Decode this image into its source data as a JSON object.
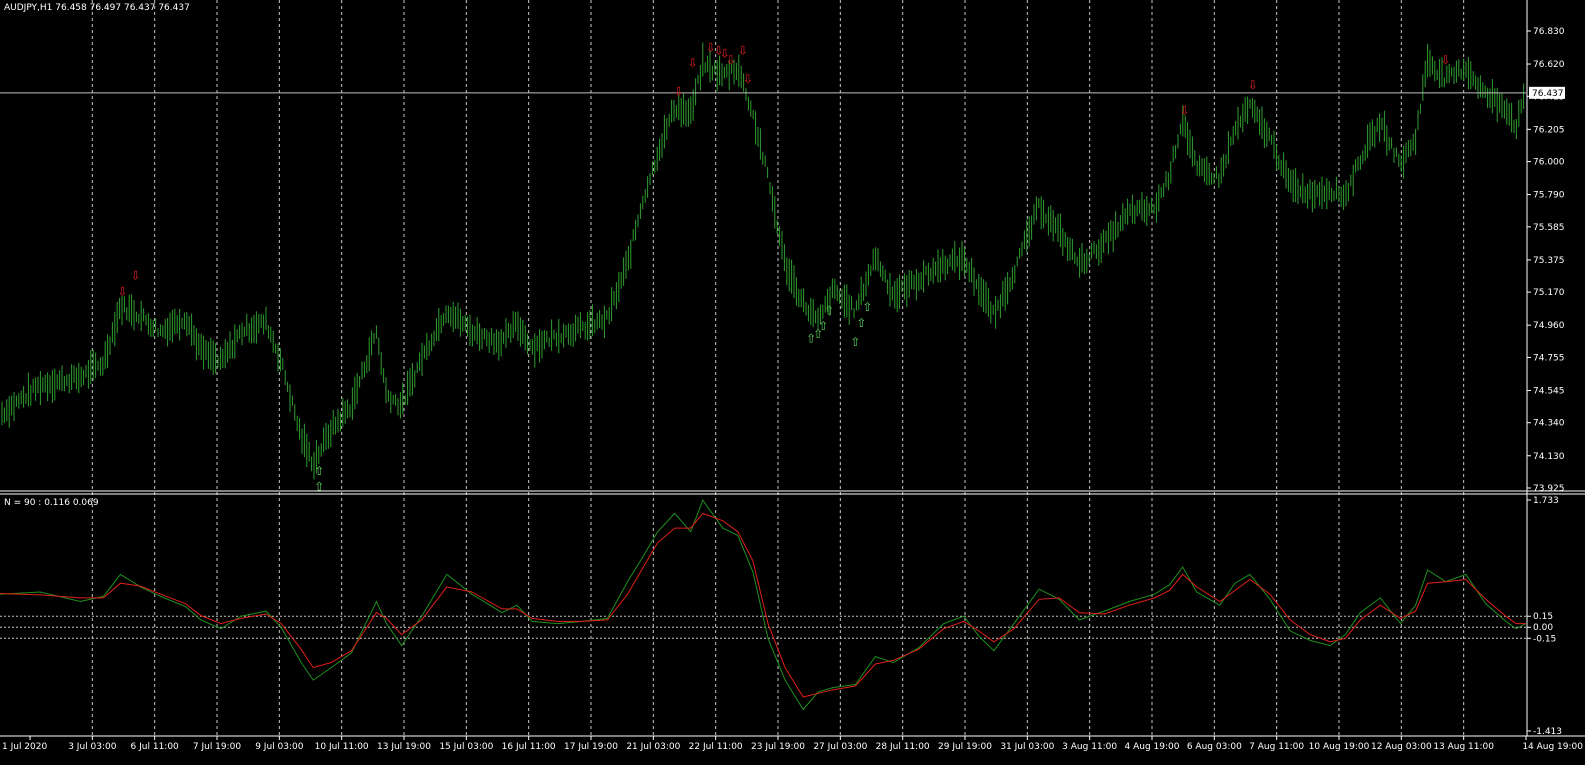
{
  "colors": {
    "background": "#000000",
    "foreground": "#ffffff",
    "grid": "#c8c8c8",
    "candle": "#2f9e2f",
    "indicator_fast": "#1f8f1f",
    "indicator_slow": "#e0201a",
    "arrow_up": "#5fd35f",
    "arrow_down": "#e02020",
    "price_line": "#c0c0c0"
  },
  "chart_data": [
    {
      "type": "candlestick",
      "header": "AUDJPY,H1  76.458 76.497 76.437 76.437",
      "symbol": "AUDJPY",
      "timeframe": "H1",
      "ohlc_last": {
        "open": 76.458,
        "high": 76.497,
        "low": 76.437,
        "close": 76.437
      },
      "current_price_label": "76.437",
      "ylim": [
        73.925,
        76.83
      ],
      "yticks": [
        "76.830",
        "76.620",
        "76.415",
        "76.205",
        "76.000",
        "75.790",
        "75.585",
        "75.375",
        "75.170",
        "74.960",
        "74.755",
        "74.545",
        "74.340",
        "74.130",
        "73.925"
      ],
      "xticks": [
        "1 Jul 2020",
        "3 Jul 03:00",
        "6 Jul 11:00",
        "7 Jul 19:00",
        "9 Jul 03:00",
        "10 Jul 11:00",
        "13 Jul 19:00",
        "15 Jul 03:00",
        "16 Jul 11:00",
        "17 Jul 19:00",
        "21 Jul 03:00",
        "22 Jul 11:00",
        "23 Jul 19:00",
        "27 Jul 03:00",
        "28 Jul 11:00",
        "29 Jul 19:00",
        "31 Jul 03:00",
        "3 Aug 11:00",
        "4 Aug 19:00",
        "6 Aug 03:00",
        "7 Aug 11:00",
        "10 Aug 19:00",
        "12 Aug 03:00",
        "13 Aug 11:00",
        "14 Aug 19:00"
      ],
      "x_index_range": [
        0,
        1520
      ],
      "price_path": [
        [
          0,
          74.39
        ],
        [
          40,
          74.58
        ],
        [
          80,
          74.63
        ],
        [
          103,
          74.72
        ],
        [
          120,
          75.08
        ],
        [
          140,
          75.02
        ],
        [
          160,
          74.92
        ],
        [
          185,
          75.01
        ],
        [
          200,
          74.8
        ],
        [
          220,
          74.72
        ],
        [
          240,
          74.92
        ],
        [
          265,
          74.98
        ],
        [
          280,
          74.73
        ],
        [
          300,
          74.25
        ],
        [
          312,
          74.08
        ],
        [
          330,
          74.3
        ],
        [
          350,
          74.45
        ],
        [
          375,
          74.92
        ],
        [
          385,
          74.52
        ],
        [
          400,
          74.45
        ],
        [
          420,
          74.75
        ],
        [
          445,
          75.06
        ],
        [
          470,
          74.92
        ],
        [
          500,
          74.85
        ],
        [
          515,
          74.97
        ],
        [
          530,
          74.82
        ],
        [
          555,
          74.9
        ],
        [
          580,
          74.94
        ],
        [
          605,
          75.0
        ],
        [
          625,
          75.35
        ],
        [
          640,
          75.75
        ],
        [
          655,
          76.05
        ],
        [
          672,
          76.35
        ],
        [
          688,
          76.3
        ],
        [
          700,
          76.62
        ],
        [
          720,
          76.55
        ],
        [
          735,
          76.6
        ],
        [
          750,
          76.3
        ],
        [
          765,
          75.9
        ],
        [
          782,
          75.35
        ],
        [
          800,
          75.1
        ],
        [
          815,
          74.98
        ],
        [
          830,
          75.18
        ],
        [
          852,
          75.05
        ],
        [
          872,
          75.4
        ],
        [
          890,
          75.15
        ],
        [
          915,
          75.25
        ],
        [
          940,
          75.35
        ],
        [
          960,
          75.38
        ],
        [
          975,
          75.2
        ],
        [
          990,
          75.02
        ],
        [
          1010,
          75.3
        ],
        [
          1035,
          75.72
        ],
        [
          1055,
          75.55
        ],
        [
          1075,
          75.35
        ],
        [
          1100,
          75.48
        ],
        [
          1125,
          75.68
        ],
        [
          1150,
          75.7
        ],
        [
          1165,
          75.92
        ],
        [
          1178,
          76.28
        ],
        [
          1192,
          75.95
        ],
        [
          1215,
          75.9
        ],
        [
          1230,
          76.2
        ],
        [
          1245,
          76.35
        ],
        [
          1265,
          76.15
        ],
        [
          1285,
          75.85
        ],
        [
          1305,
          75.8
        ],
        [
          1325,
          75.82
        ],
        [
          1340,
          75.78
        ],
        [
          1355,
          76.02
        ],
        [
          1375,
          76.25
        ],
        [
          1395,
          75.98
        ],
        [
          1410,
          76.15
        ],
        [
          1422,
          76.65
        ],
        [
          1440,
          76.52
        ],
        [
          1460,
          76.6
        ],
        [
          1480,
          76.42
        ],
        [
          1500,
          76.35
        ],
        [
          1510,
          76.22
        ],
        [
          1520,
          76.44
        ]
      ],
      "signals_down": [
        [
          122,
          75.15
        ],
        [
          135,
          75.25
        ],
        [
          676,
          76.42
        ],
        [
          690,
          76.6
        ],
        [
          708,
          76.7
        ],
        [
          716,
          76.68
        ],
        [
          722,
          76.66
        ],
        [
          728,
          76.62
        ],
        [
          740,
          76.68
        ],
        [
          745,
          76.5
        ],
        [
          1180,
          76.3
        ],
        [
          1248,
          76.46
        ],
        [
          1440,
          76.62
        ]
      ],
      "signals_up": [
        [
          318,
          74.06
        ],
        [
          318,
          73.96
        ],
        [
          808,
          74.9
        ],
        [
          815,
          74.93
        ],
        [
          820,
          74.98
        ],
        [
          826,
          75.08
        ],
        [
          852,
          74.88
        ],
        [
          858,
          75.0
        ],
        [
          864,
          75.1
        ]
      ]
    },
    {
      "type": "line",
      "header": "N = 90 :  0.116 0.069",
      "ylim": [
        -1.413,
        1.733
      ],
      "yticks": [
        "1.733",
        "0.15",
        "0.00",
        "-0.15",
        "-1.413"
      ],
      "levels": [
        0.15,
        0.0,
        -0.15
      ],
      "x_index_range": [
        0,
        1520
      ],
      "series": [
        {
          "key": "fast",
          "values": [
            [
              0,
              0.45
            ],
            [
              40,
              0.48
            ],
            [
              80,
              0.35
            ],
            [
              103,
              0.42
            ],
            [
              120,
              0.72
            ],
            [
              140,
              0.55
            ],
            [
              160,
              0.42
            ],
            [
              185,
              0.28
            ],
            [
              200,
              0.1
            ],
            [
              220,
              -0.02
            ],
            [
              240,
              0.15
            ],
            [
              265,
              0.22
            ],
            [
              280,
              0.0
            ],
            [
              300,
              -0.48
            ],
            [
              312,
              -0.72
            ],
            [
              330,
              -0.55
            ],
            [
              350,
              -0.35
            ],
            [
              375,
              0.35
            ],
            [
              385,
              0.05
            ],
            [
              400,
              -0.25
            ],
            [
              420,
              0.15
            ],
            [
              445,
              0.72
            ],
            [
              470,
              0.45
            ],
            [
              500,
              0.2
            ],
            [
              515,
              0.3
            ],
            [
              530,
              0.08
            ],
            [
              555,
              0.05
            ],
            [
              580,
              0.08
            ],
            [
              605,
              0.12
            ],
            [
              625,
              0.62
            ],
            [
              640,
              0.95
            ],
            [
              655,
              1.3
            ],
            [
              672,
              1.55
            ],
            [
              688,
              1.3
            ],
            [
              700,
              1.73
            ],
            [
              720,
              1.35
            ],
            [
              735,
              1.25
            ],
            [
              750,
              0.75
            ],
            [
              765,
              -0.15
            ],
            [
              782,
              -0.72
            ],
            [
              800,
              -1.12
            ],
            [
              815,
              -0.88
            ],
            [
              830,
              -0.82
            ],
            [
              852,
              -0.78
            ],
            [
              872,
              -0.4
            ],
            [
              890,
              -0.48
            ],
            [
              915,
              -0.28
            ],
            [
              940,
              0.05
            ],
            [
              960,
              0.15
            ],
            [
              975,
              -0.12
            ],
            [
              990,
              -0.32
            ],
            [
              1010,
              0.05
            ],
            [
              1035,
              0.52
            ],
            [
              1055,
              0.38
            ],
            [
              1075,
              0.1
            ],
            [
              1100,
              0.22
            ],
            [
              1125,
              0.35
            ],
            [
              1150,
              0.45
            ],
            [
              1165,
              0.58
            ],
            [
              1178,
              0.82
            ],
            [
              1192,
              0.48
            ],
            [
              1215,
              0.3
            ],
            [
              1230,
              0.6
            ],
            [
              1245,
              0.72
            ],
            [
              1265,
              0.38
            ],
            [
              1285,
              -0.05
            ],
            [
              1305,
              -0.18
            ],
            [
              1325,
              -0.25
            ],
            [
              1340,
              -0.1
            ],
            [
              1355,
              0.2
            ],
            [
              1375,
              0.4
            ],
            [
              1395,
              0.05
            ],
            [
              1410,
              0.3
            ],
            [
              1422,
              0.78
            ],
            [
              1440,
              0.62
            ],
            [
              1460,
              0.72
            ],
            [
              1480,
              0.32
            ],
            [
              1500,
              0.08
            ],
            [
              1510,
              -0.02
            ],
            [
              1520,
              0.05
            ]
          ]
        },
        {
          "key": "slow",
          "values": [
            [
              0,
              0.46
            ],
            [
              40,
              0.44
            ],
            [
              80,
              0.4
            ],
            [
              103,
              0.4
            ],
            [
              120,
              0.6
            ],
            [
              140,
              0.56
            ],
            [
              160,
              0.45
            ],
            [
              185,
              0.32
            ],
            [
              200,
              0.16
            ],
            [
              220,
              0.05
            ],
            [
              240,
              0.12
            ],
            [
              265,
              0.18
            ],
            [
              280,
              0.05
            ],
            [
              300,
              -0.3
            ],
            [
              312,
              -0.55
            ],
            [
              330,
              -0.48
            ],
            [
              350,
              -0.32
            ],
            [
              375,
              0.2
            ],
            [
              385,
              0.12
            ],
            [
              400,
              -0.1
            ],
            [
              420,
              0.1
            ],
            [
              445,
              0.55
            ],
            [
              470,
              0.48
            ],
            [
              500,
              0.25
            ],
            [
              515,
              0.25
            ],
            [
              530,
              0.12
            ],
            [
              555,
              0.08
            ],
            [
              580,
              0.08
            ],
            [
              605,
              0.1
            ],
            [
              625,
              0.45
            ],
            [
              640,
              0.8
            ],
            [
              655,
              1.15
            ],
            [
              672,
              1.35
            ],
            [
              688,
              1.35
            ],
            [
              700,
              1.55
            ],
            [
              720,
              1.45
            ],
            [
              735,
              1.3
            ],
            [
              750,
              0.9
            ],
            [
              765,
              0.05
            ],
            [
              782,
              -0.55
            ],
            [
              800,
              -0.95
            ],
            [
              815,
              -0.9
            ],
            [
              830,
              -0.85
            ],
            [
              852,
              -0.8
            ],
            [
              872,
              -0.5
            ],
            [
              890,
              -0.45
            ],
            [
              915,
              -0.3
            ],
            [
              940,
              -0.02
            ],
            [
              960,
              0.08
            ],
            [
              975,
              -0.05
            ],
            [
              990,
              -0.2
            ],
            [
              1010,
              -0.02
            ],
            [
              1035,
              0.38
            ],
            [
              1055,
              0.4
            ],
            [
              1075,
              0.2
            ],
            [
              1100,
              0.18
            ],
            [
              1125,
              0.3
            ],
            [
              1150,
              0.4
            ],
            [
              1165,
              0.5
            ],
            [
              1178,
              0.72
            ],
            [
              1192,
              0.55
            ],
            [
              1215,
              0.35
            ],
            [
              1230,
              0.5
            ],
            [
              1245,
              0.65
            ],
            [
              1265,
              0.45
            ],
            [
              1285,
              0.1
            ],
            [
              1305,
              -0.1
            ],
            [
              1325,
              -0.2
            ],
            [
              1340,
              -0.15
            ],
            [
              1355,
              0.1
            ],
            [
              1375,
              0.3
            ],
            [
              1395,
              0.12
            ],
            [
              1410,
              0.22
            ],
            [
              1422,
              0.6
            ],
            [
              1440,
              0.62
            ],
            [
              1460,
              0.65
            ],
            [
              1480,
              0.38
            ],
            [
              1500,
              0.15
            ],
            [
              1510,
              0.05
            ],
            [
              1520,
              0.05
            ]
          ]
        }
      ]
    }
  ]
}
